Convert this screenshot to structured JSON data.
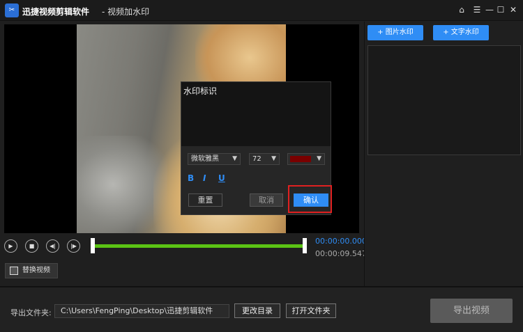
{
  "window": {
    "app_name": "迅捷视频剪辑软件",
    "subtitle": "- 视频加水印",
    "logo_icon": "scissors-logo-icon",
    "home_icon": "⌂",
    "menu_icon": "☰",
    "minimize_icon": "—",
    "maximize_icon": "☐",
    "close_icon": "✕"
  },
  "watermark_dialog": {
    "text": "水印标识",
    "font": "微软雅黑",
    "size": "72",
    "color": "#7a0000",
    "bold_label": "B",
    "italic_label": "I",
    "underline_label": "U",
    "reset_label": "重置",
    "cancel_label": "取消",
    "confirm_label": "确认"
  },
  "player": {
    "play_icon": "▶",
    "stop_icon": "■",
    "prev_icon": "◀|",
    "next_icon": "|▶",
    "current_time": "00:00:00.000",
    "total_time": "00:00:09.547",
    "replace_label": "替换视频"
  },
  "right_panel": {
    "image_watermark_label": "+ 图片水印",
    "text_watermark_label": "+ 文字水印"
  },
  "bottom": {
    "output_label": "导出文件夹:",
    "output_path": "C:\\Users\\FengPing\\Desktop\\迅捷剪辑软件",
    "change_dir_label": "更改目录",
    "open_folder_label": "打开文件夹",
    "export_label": "导出视频"
  }
}
